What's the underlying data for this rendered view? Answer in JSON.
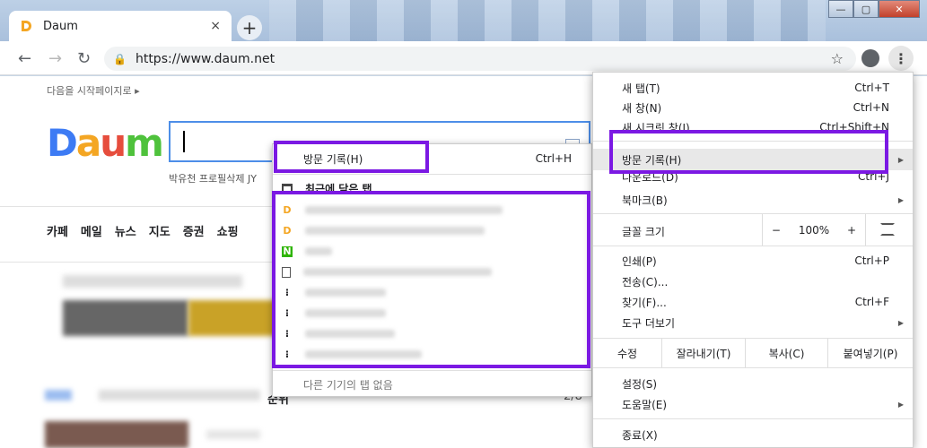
{
  "tab": {
    "title": "Daum",
    "close": "×"
  },
  "newtab": "+",
  "window_buttons": {
    "min": "—",
    "max": "▢",
    "close": "✕"
  },
  "toolbar": {
    "back": "←",
    "forward": "→",
    "reload": "↻",
    "url": "https://www.daum.net",
    "star": "☆"
  },
  "page": {
    "start_link": "다음을 시작페이지로 ▸",
    "logo": "Daum",
    "trend": "박유천 프로필삭제  JY",
    "nav": [
      "카페",
      "메일",
      "뉴스",
      "지도",
      "증권",
      "쇼핑"
    ],
    "ranking_title": "순위",
    "ranking_page": "2/8"
  },
  "submenu": {
    "header_label": "방문 기록(H)",
    "header_shortcut": "Ctrl+H",
    "recent_label": "최근에 닫은 탭",
    "history_icons": [
      "daum-icon",
      "daum-icon",
      "naver-icon",
      "document-icon",
      "dots-icon",
      "dots-icon",
      "dots-icon",
      "dots-icon"
    ],
    "other_devices": "다른 기기의 탭 없음"
  },
  "menu": {
    "new_tab": "새 탭(T)",
    "new_tab_sc": "Ctrl+T",
    "new_window": "새 창(N)",
    "new_window_sc": "Ctrl+N",
    "incognito": "새 시크릿 창(I)",
    "incognito_sc": "Ctrl+Shift+N",
    "history": "방문 기록(H)",
    "downloads": "다운로드(D)",
    "downloads_sc": "Ctrl+J",
    "bookmarks": "북마크(B)",
    "zoom_label": "글꼴 크기",
    "zoom_minus": "−",
    "zoom_value": "100%",
    "zoom_plus": "+",
    "print": "인쇄(P)",
    "print_sc": "Ctrl+P",
    "cast": "전송(C)...",
    "find": "찾기(F)...",
    "find_sc": "Ctrl+F",
    "more_tools": "도구 더보기",
    "edit": "수정",
    "cut": "잘라내기(T)",
    "copy": "복사(C)",
    "paste": "붙여넣기(P)",
    "settings": "설정(S)",
    "help": "도움말(E)",
    "exit": "종료(X)"
  },
  "colors": {
    "highlight": "#7b19e3",
    "search_border": "#4d8ee8"
  }
}
